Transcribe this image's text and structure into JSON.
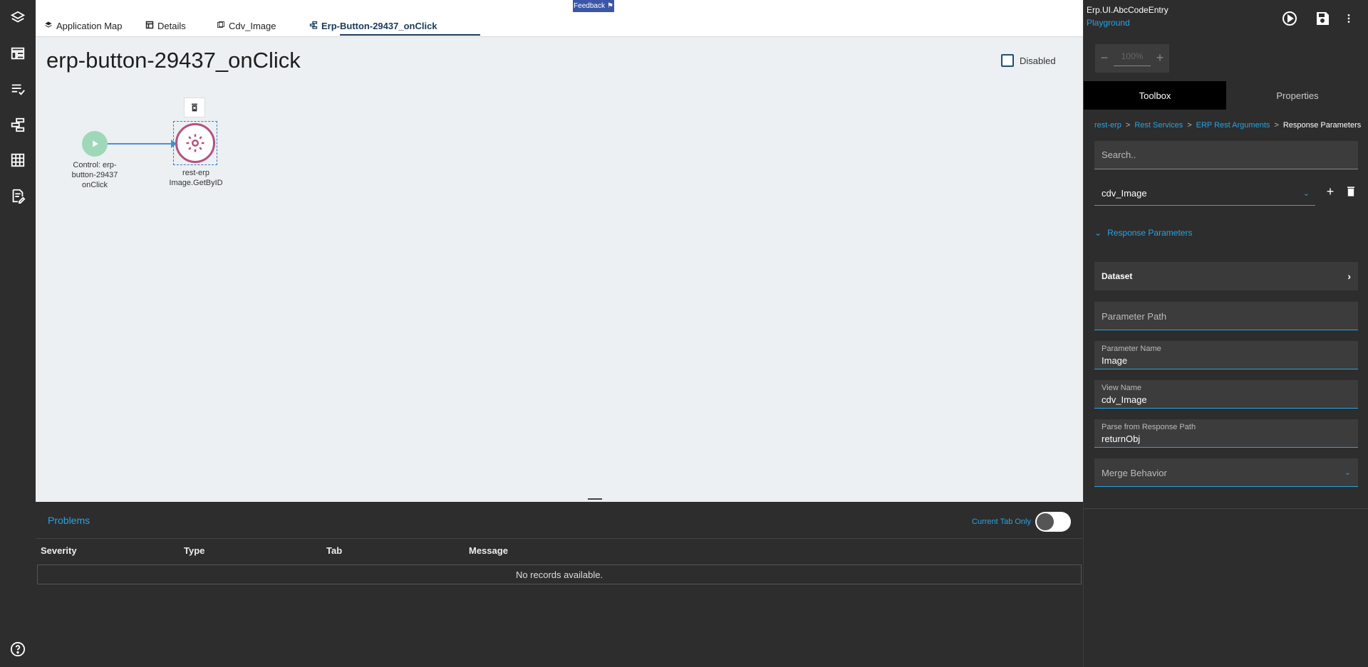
{
  "tabs": [
    {
      "label": "Application Map",
      "icon": "layers-icon"
    },
    {
      "label": "Details",
      "icon": "table-icon"
    },
    {
      "label": "Cdv_Image",
      "icon": "view-icon"
    },
    {
      "label": "Erp-Button-29437_onClick",
      "icon": "flow-icon",
      "active": true
    }
  ],
  "feedback_label": "Feedback",
  "canvas": {
    "title": "erp-button-29437_onClick",
    "disabled_label": "Disabled",
    "start_node": {
      "label_line1": "Control: erp-",
      "label_line2": "button-29437",
      "label_line3": "onClick"
    },
    "action_node": {
      "label_line1": "rest-erp",
      "label_line2": "Image.GetByID"
    }
  },
  "problems": {
    "title": "Problems",
    "current_tab_only": "Current Tab Only",
    "columns": [
      "Severity",
      "Type",
      "Tab",
      "Message"
    ],
    "empty": "No records available."
  },
  "right": {
    "app_name": "Erp.UI.AbcCodeEntry",
    "env": "Playground",
    "zoom": "100%",
    "tabs": [
      "Toolbox",
      "Properties"
    ],
    "breadcrumb": [
      "rest-erp",
      "Rest Services",
      "ERP Rest Arguments",
      "Response Parameters"
    ],
    "search_placeholder": "Search..",
    "selected_item": "cdv_Image",
    "section_title": "Response Parameters",
    "dataset_label": "Dataset",
    "param_path_label": "Parameter Path",
    "param_name": {
      "label": "Parameter Name",
      "value": "Image"
    },
    "view_name": {
      "label": "View Name",
      "value": "cdv_Image"
    },
    "parse_path": {
      "label": "Parse from Response Path",
      "value": "returnObj"
    },
    "merge_behavior_label": "Merge Behavior"
  },
  "colors": {
    "accent": "#29a3e0",
    "dark": "#2d2d2d",
    "start_node": "#9fd8b9",
    "action_node": "#b5517e"
  }
}
